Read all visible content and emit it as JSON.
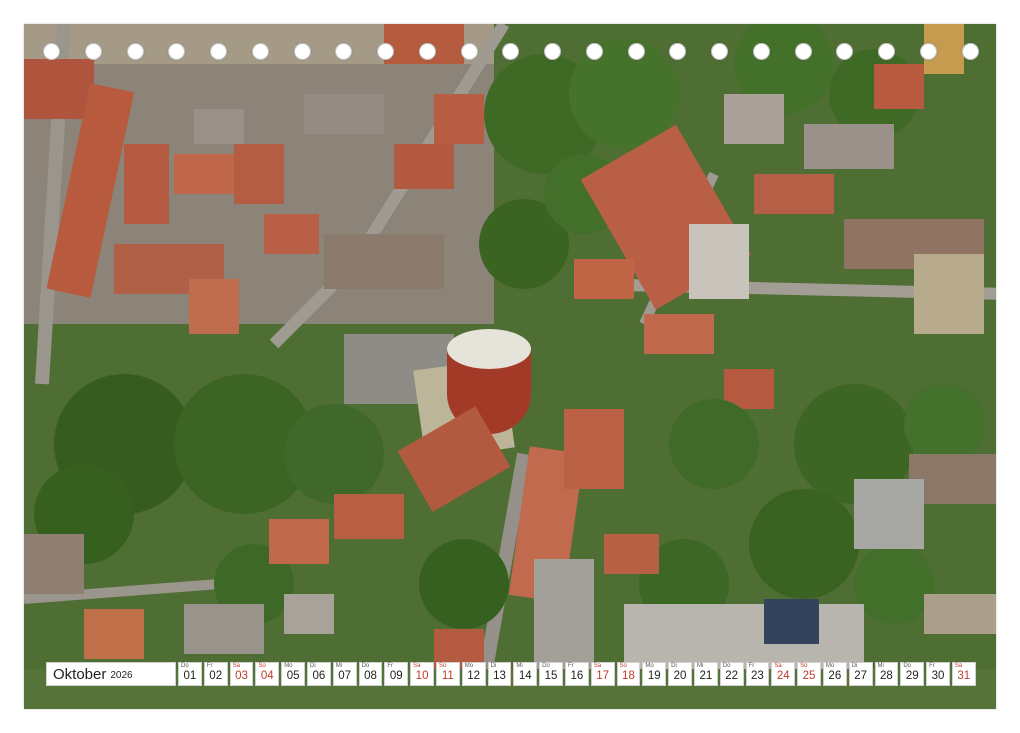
{
  "calendar": {
    "month": "Oktober",
    "year": "2026",
    "weekend_color": "#c0392b",
    "days": [
      {
        "wd": "Do",
        "n": "01",
        "red": false
      },
      {
        "wd": "Fr",
        "n": "02",
        "red": false
      },
      {
        "wd": "Sa",
        "n": "03",
        "red": true
      },
      {
        "wd": "So",
        "n": "04",
        "red": true
      },
      {
        "wd": "Mo",
        "n": "05",
        "red": false
      },
      {
        "wd": "Di",
        "n": "06",
        "red": false
      },
      {
        "wd": "Mi",
        "n": "07",
        "red": false
      },
      {
        "wd": "Do",
        "n": "08",
        "red": false
      },
      {
        "wd": "Fr",
        "n": "09",
        "red": false
      },
      {
        "wd": "Sa",
        "n": "10",
        "red": true
      },
      {
        "wd": "So",
        "n": "11",
        "red": true
      },
      {
        "wd": "Mo",
        "n": "12",
        "red": false
      },
      {
        "wd": "Di",
        "n": "13",
        "red": false
      },
      {
        "wd": "Mi",
        "n": "14",
        "red": false
      },
      {
        "wd": "Do",
        "n": "15",
        "red": false
      },
      {
        "wd": "Fr",
        "n": "16",
        "red": false
      },
      {
        "wd": "Sa",
        "n": "17",
        "red": true
      },
      {
        "wd": "So",
        "n": "18",
        "red": true
      },
      {
        "wd": "Mo",
        "n": "19",
        "red": false
      },
      {
        "wd": "Di",
        "n": "20",
        "red": false
      },
      {
        "wd": "Mi",
        "n": "21",
        "red": false
      },
      {
        "wd": "Do",
        "n": "22",
        "red": false
      },
      {
        "wd": "Fr",
        "n": "23",
        "red": false
      },
      {
        "wd": "Sa",
        "n": "24",
        "red": true
      },
      {
        "wd": "So",
        "n": "25",
        "red": true
      },
      {
        "wd": "Mo",
        "n": "26",
        "red": false
      },
      {
        "wd": "Di",
        "n": "27",
        "red": false
      },
      {
        "wd": "Mi",
        "n": "28",
        "red": false
      },
      {
        "wd": "Do",
        "n": "29",
        "red": false
      },
      {
        "wd": "Fr",
        "n": "30",
        "red": false
      },
      {
        "wd": "Sa",
        "n": "31",
        "red": true
      }
    ]
  },
  "photo": {
    "subject": "aerial-city-view",
    "hole_count": 23
  }
}
